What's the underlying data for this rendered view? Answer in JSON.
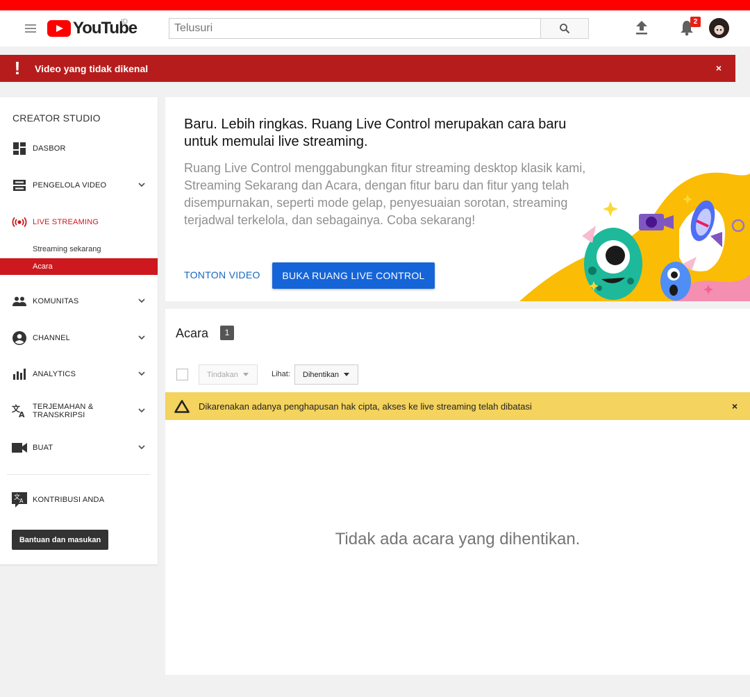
{
  "masthead": {
    "logo_text": "YouTube",
    "country": "ID",
    "search_placeholder": "Telusuri",
    "notification_count": "2"
  },
  "alert": {
    "icon": "!",
    "message": "Video yang tidak dikenal",
    "close": "×"
  },
  "sidebar": {
    "title": "CREATOR STUDIO",
    "items": {
      "dasbor": "DASBOR",
      "pengelola": "PENGELOLA VIDEO",
      "live": "LIVE STREAMING",
      "komunitas": "KOMUNITAS",
      "channel": "CHANNEL",
      "analytics": "ANALYTICS",
      "terjemahan_1": "TERJEMAHAN &",
      "terjemahan_2": "TRANSKRIPSI",
      "buat": "BUAT",
      "kontribusi": "KONTRIBUSI ANDA"
    },
    "sub_items": {
      "streaming": "Streaming sekarang",
      "acara": "Acara"
    },
    "help_button": "Bantuan dan masukan"
  },
  "promo": {
    "title": "Baru. Lebih ringkas. Ruang Live Control merupakan cara baru untuk memulai live streaming.",
    "body": "Ruang Live Control menggabungkan fitur streaming desktop klasik kami, Streaming Sekarang dan Acara, dengan fitur baru dan fitur yang telah disempurnakan, seperti mode gelap, penyesuaian sorotan, streaming terjadwal terkelola, dan sebagainya. Coba sekarang!",
    "watch_link": "TONTON VIDEO",
    "open_button": "BUKA RUANG LIVE CONTROL"
  },
  "events": {
    "title": "Acara",
    "count": "1",
    "action_dropdown": "Tindakan",
    "view_label": "Lihat:",
    "view_value": "Dihentikan",
    "warning": "Dikarenakan adanya penghapusan hak cipta, akses ke live streaming telah dibatasi",
    "warning_close": "×",
    "empty_message": "Tidak ada acara yang dihentikan."
  },
  "colors": {
    "brand_red": "#ff0000",
    "alert_red": "#b71c1c",
    "active_red": "#cc181e",
    "primary_blue": "#1565d8",
    "warning_yellow": "#f4d35e"
  }
}
